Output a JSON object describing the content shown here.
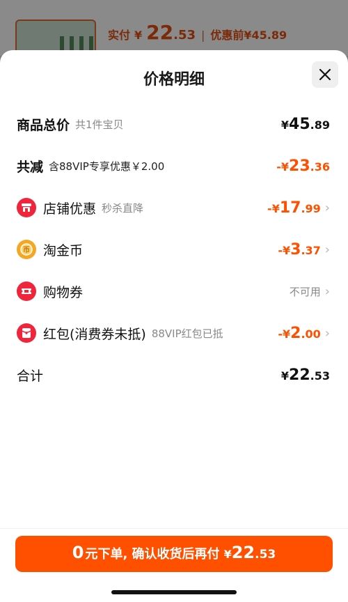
{
  "background": {
    "paid_label": "实付",
    "paid_currency": "¥",
    "paid_int": "22",
    "paid_dec": ".53",
    "separator": "|",
    "before_label": "优惠前¥45.89"
  },
  "sheet": {
    "title": "价格明细"
  },
  "rows": {
    "total": {
      "label": "商品总价",
      "sub": "共1件宝贝",
      "currency": "¥",
      "int": "45",
      "dec": ".89"
    },
    "reduce": {
      "label": "共减",
      "sub": "含88VIP专享优惠￥2.00",
      "currency": "-¥",
      "int": "23",
      "dec": ".36"
    },
    "shop": {
      "label": "店铺优惠",
      "sub": "秒杀直降",
      "currency": "-¥",
      "int": "17",
      "dec": ".99",
      "icon": "shop-icon"
    },
    "coin": {
      "label": "淘金币",
      "currency": "-¥",
      "int": "3",
      "dec": ".37",
      "icon": "coin-icon"
    },
    "coupon": {
      "label": "购物券",
      "value": "不可用",
      "icon": "ticket-icon"
    },
    "redpacket": {
      "label": "红包(消费券未抵)",
      "sub": "88VIP红包已抵",
      "currency": "-¥",
      "int": "2",
      "dec": ".00",
      "icon": "red-packet-icon"
    },
    "sum": {
      "label": "合计",
      "currency": "¥",
      "int": "22",
      "dec": ".53"
    }
  },
  "cta": {
    "zero": "0",
    "text": "元下单, 确认收货后再付",
    "currency": "¥",
    "int": "22",
    "dec": ".53"
  },
  "colors": {
    "accent": "#ff5000",
    "icon_red": "#f0243a",
    "icon_gold": "#f5a623"
  }
}
